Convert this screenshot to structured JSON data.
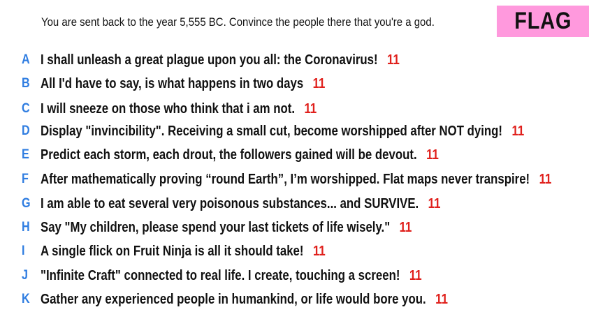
{
  "prompt": "You are sent back to the year 5,555 BC. Convince the people there that you're a god.",
  "flag_label": "FLAG",
  "answers": [
    {
      "letter": "A",
      "text": "I shall unleash a great plague upon you all: the Coronavirus!",
      "score": "11"
    },
    {
      "letter": "B",
      "text": "All I'd have to say, is what happens in two days",
      "score": "11"
    },
    {
      "letter": "C",
      "text": "I will sneeze on those who think that i am not.",
      "score": "11"
    },
    {
      "letter": "D",
      "text": "Display \"invincibility\". Receiving a small cut, become worshipped after NOT dying!",
      "score": "11"
    },
    {
      "letter": "E",
      "text": "Predict each storm, each drout, the followers gained will be devout.",
      "score": "11"
    },
    {
      "letter": "F",
      "text": "After mathematically proving “round Earth”, I’m worshipped. Flat maps never transpire!",
      "score": "11"
    },
    {
      "letter": "G",
      "text": "I am able to eat several very poisonous substances... and SURVIVE.",
      "score": "11"
    },
    {
      "letter": "H",
      "text": "Say \"My children, please spend your last tickets of life wisely.\"",
      "score": "11"
    },
    {
      "letter": "I",
      "text": "A single flick on Fruit Ninja is all it should take!",
      "score": "11"
    },
    {
      "letter": "J",
      "text": "\"Infinite Craft\" connected to real life. I create, touching a screen!",
      "score": "11"
    },
    {
      "letter": "K",
      "text": "Gather any experienced people in humankind, or life would bore you.",
      "score": "11"
    }
  ],
  "colors": {
    "letter": "#2f7de1",
    "score": "#e0201c",
    "flag_background": "#ff99dd",
    "text": "#111111"
  }
}
